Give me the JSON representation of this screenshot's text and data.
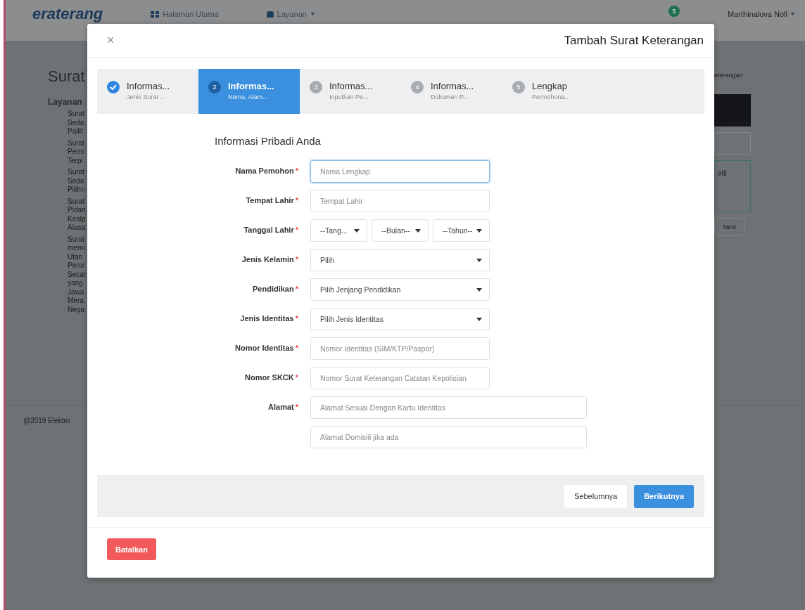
{
  "background": {
    "logo": "eraterang",
    "nav": [
      {
        "label": "Halaman Utama",
        "kind": "home"
      },
      {
        "label": "Layanan",
        "kind": "menu"
      }
    ],
    "notification_count": "5",
    "user": "Marthinalova Noll",
    "page_title": "Surat",
    "sidebar_heading": "Layanan",
    "sidebar_items": [
      [
        "Surat",
        "Seda",
        "Pailit"
      ],
      [
        "Surat",
        "Perni",
        "Terpi"
      ],
      [
        "Surat",
        "Seda",
        "Pilihn"
      ],
      [
        "Surat",
        "Pidan",
        "Kealp",
        "Alasa"
      ],
      [
        "Surat",
        "memi",
        "Utan",
        "Peror",
        "Secar",
        "yang",
        "Jawa",
        "Mera",
        "Nega"
      ]
    ],
    "breadcrumb": "eterangan",
    "panel_text": "etil",
    "next_button": "Next",
    "footer": "@2019 Elektro"
  },
  "modal": {
    "title": "Tambah Surat Keterangan",
    "close": "×",
    "steps": [
      {
        "title": "Informas...",
        "subtitle": "Jenis Surat ...",
        "done": true,
        "selected": false
      },
      {
        "number": "2",
        "title": "Informas...",
        "subtitle": "Nama, Alam...",
        "done": false,
        "selected": true
      },
      {
        "number": "3",
        "title": "Informas...",
        "subtitle": "Inputkan Pe...",
        "done": false,
        "selected": false
      },
      {
        "number": "4",
        "title": "Informas...",
        "subtitle": "Dokumen P...",
        "done": false,
        "selected": false
      },
      {
        "number": "5",
        "title": "Lengkap",
        "subtitle": "Permohona...",
        "done": false,
        "selected": false
      }
    ],
    "section_title": "Informasi Pribadi Anda",
    "fields": [
      {
        "kind": "text",
        "label": "Nama Pemohon",
        "required": true,
        "placeholder": "Nama Lengkap",
        "focused": true
      },
      {
        "kind": "text",
        "label": "Tempat Lahir",
        "required": true,
        "placeholder": "Tempat Lahir",
        "focused": false
      },
      {
        "kind": "date",
        "label": "Tanggal Lahir",
        "required": true,
        "parts": [
          "--Tang...",
          "--Bulan--",
          "--Tahun--"
        ]
      },
      {
        "kind": "select",
        "label": "Jenis Kelamin",
        "required": true,
        "value": "Pilih"
      },
      {
        "kind": "select",
        "label": "Pendidikan",
        "required": true,
        "value": "Pilih Jenjang Pendidikan"
      },
      {
        "kind": "select",
        "label": "Jenis Identitas",
        "required": true,
        "value": "Pilih Jenis Identitas"
      },
      {
        "kind": "text",
        "label": "Nomor Identitas",
        "required": true,
        "placeholder": "Nomor Identitas (SIM/KTP/Paspor)",
        "focused": false
      },
      {
        "kind": "text",
        "label": "Nomor SKCK",
        "required": true,
        "placeholder": "Nomor Surat Keterangan Catatan Kepolisian",
        "focused": false
      },
      {
        "kind": "address",
        "label": "Alamat",
        "required": true,
        "placeholders": [
          "Alamat Sesuai Dengan Kartu Identitas",
          "Alamat Domisili jika ada"
        ]
      }
    ],
    "required_mark": "*",
    "prev_button": "Sebelumnya",
    "next_button": "Berikutnya",
    "cancel_button": "Batalkan"
  }
}
